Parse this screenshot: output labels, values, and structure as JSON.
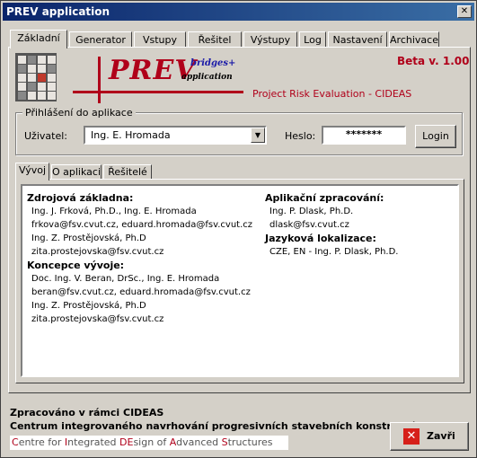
{
  "window": {
    "title": "PREV application"
  },
  "tabs": [
    "Základní",
    "Generator",
    "Vstupy",
    "Řešitel",
    "Výstupy",
    "Log",
    "Nastavení",
    "Archivace"
  ],
  "logo": {
    "prev": "PREV",
    "bridges": "bridges+",
    "application": "application",
    "subtitle": "Project Risk Evaluation - CIDEAS",
    "version": "Beta v. 1.00"
  },
  "login": {
    "legend": "Přihlášení do aplikace",
    "user_label": "Uživatel:",
    "user_value": "Ing. E. Hromada",
    "password_label": "Heslo:",
    "password_value": "*******",
    "login_button": "Login"
  },
  "subtabs": [
    "Vývoj",
    "O aplikaci",
    "Řešitelé"
  ],
  "left_column": [
    {
      "type": "h",
      "text": "Zdrojová základna:"
    },
    {
      "type": "t",
      "text": "Ing. J. Frková, Ph.D., Ing. E. Hromada"
    },
    {
      "type": "t",
      "text": "frkova@fsv.cvut.cz, eduard.hromada@fsv.cvut.cz"
    },
    {
      "type": "t",
      "text": "Ing. Z. Prostějovská, Ph.D"
    },
    {
      "type": "t",
      "text": "zita.prostejovska@fsv.cvut.cz"
    },
    {
      "type": "h",
      "text": "Koncepce vývoje:"
    },
    {
      "type": "t",
      "text": "Doc. Ing. V. Beran, DrSc., Ing. E. Hromada"
    },
    {
      "type": "t",
      "text": "beran@fsv.cvut.cz, eduard.hromada@fsv.cvut.cz"
    },
    {
      "type": "t",
      "text": "Ing. Z. Prostějovská, Ph.D"
    },
    {
      "type": "t",
      "text": "zita.prostejovska@fsv.cvut.cz"
    }
  ],
  "right_column": [
    {
      "type": "h",
      "text": "Aplikační zpracování:"
    },
    {
      "type": "t",
      "text": "Ing. P. Dlask, Ph.D."
    },
    {
      "type": "t",
      "text": "dlask@fsv.cvut.cz"
    },
    {
      "type": "h",
      "text": "Jazyková lokalizace:"
    },
    {
      "type": "t",
      "text": "CZE, EN - Ing. P. Dlask, Ph.D."
    }
  ],
  "footer": {
    "line1": "Zpracováno v rámci CIDEAS",
    "line2": "Centrum integrovaného navrhování progresivních stavebních konstrukcí",
    "line3_parts": [
      "C",
      "entre for ",
      "I",
      "ntegrated ",
      "DE",
      "sign of ",
      "A",
      "dvanced ",
      "S",
      "tructures"
    ],
    "close_button": "Zavři"
  },
  "colors": {
    "accent_red": "#b0001a",
    "title_blue": "#0a246a"
  }
}
